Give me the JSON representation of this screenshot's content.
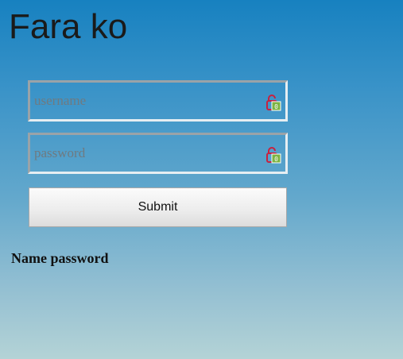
{
  "page": {
    "title": "Fara ko"
  },
  "form": {
    "username": {
      "placeholder": "username",
      "value": "",
      "icon": "password-manager-lock-icon"
    },
    "password": {
      "placeholder": "password",
      "value": "",
      "icon": "password-manager-lock-icon",
      "icon_badge": "0"
    },
    "submit_label": "Submit"
  },
  "result": {
    "text": "Name password"
  },
  "colors": {
    "lock": "#c8213f",
    "badge": "#7cb342"
  }
}
